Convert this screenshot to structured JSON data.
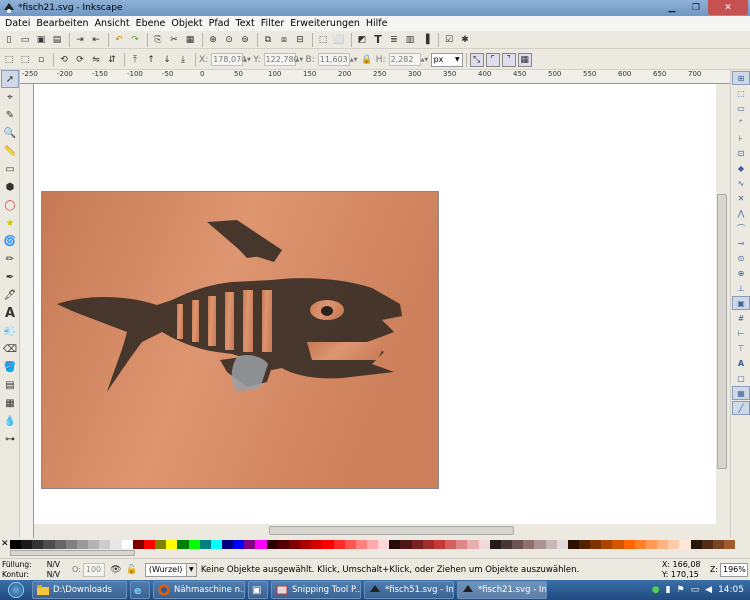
{
  "window": {
    "title": "*fisch21.svg - Inkscape"
  },
  "menu": [
    "Datei",
    "Bearbeiten",
    "Ansicht",
    "Ebene",
    "Objekt",
    "Pfad",
    "Text",
    "Filter",
    "Erweiterungen",
    "Hilfe"
  ],
  "controls": {
    "x_label": "X:",
    "x_value": "178,074",
    "y_label": "Y:",
    "y_value": "122,780",
    "w_label": "B:",
    "w_value": "11,603",
    "h_label": "H:",
    "h_value": "2,282",
    "unit": "px"
  },
  "ruler_ticks": [
    "-250",
    "-200",
    "-150",
    "-100",
    "-50",
    "0",
    "50",
    "100",
    "150",
    "200",
    "250",
    "300",
    "350",
    "400",
    "450",
    "500",
    "550",
    "600",
    "650",
    "700"
  ],
  "status": {
    "fill_label": "Füllung:",
    "fill_value": "N/V",
    "stroke_label": "Kontur:",
    "stroke_value": "N/V",
    "opacity_label": "O:",
    "opacity_value": "100",
    "layer": "(Wurzel)",
    "message": "Keine Objekte ausgewählt. Klick, Umschalt+Klick, oder Ziehen um Objekte auszuwählen.",
    "x_coord": "X: 166,08",
    "y_coord": "Y: 170,15",
    "zoom_label": "Z:",
    "zoom_value": "196%"
  },
  "taskbar": {
    "tasks": [
      "D:\\Downloads",
      "Nähmaschine n...",
      "Snipping Tool P...",
      "*fisch51.svg - In...",
      "*fisch21.svg - In..."
    ],
    "time": "14:05"
  },
  "palette": [
    "#000000",
    "#1a1a1a",
    "#333333",
    "#4d4d4d",
    "#666666",
    "#808080",
    "#999999",
    "#b3b3b3",
    "#cccccc",
    "#e6e6e6",
    "#ffffff",
    "#800000",
    "#ff0000",
    "#808000",
    "#ffff00",
    "#008000",
    "#00ff00",
    "#008080",
    "#00ffff",
    "#000080",
    "#0000ff",
    "#800080",
    "#ff00ff",
    "#2b0000",
    "#550000",
    "#800000",
    "#aa0000",
    "#d40000",
    "#ff0000",
    "#ff2a2a",
    "#ff5555",
    "#ff8080",
    "#ffaaaa",
    "#ffd5d5",
    "#280b0b",
    "#501616",
    "#782121",
    "#a02c2c",
    "#c83737",
    "#d35f5f",
    "#de8787",
    "#e9afaf",
    "#f4d7d7",
    "#241c1c",
    "#483737",
    "#6c5353",
    "#916f6f",
    "#ac9393",
    "#c8b7b7",
    "#e3dbdb",
    "#2b1100",
    "#552200",
    "#803300",
    "#aa4400",
    "#d45500",
    "#ff6600",
    "#ff7f2a",
    "#ff9955",
    "#ffb380",
    "#ffccaa",
    "#ffe6d5",
    "#28170b",
    "#502d16",
    "#784421",
    "#a05a2c"
  ]
}
